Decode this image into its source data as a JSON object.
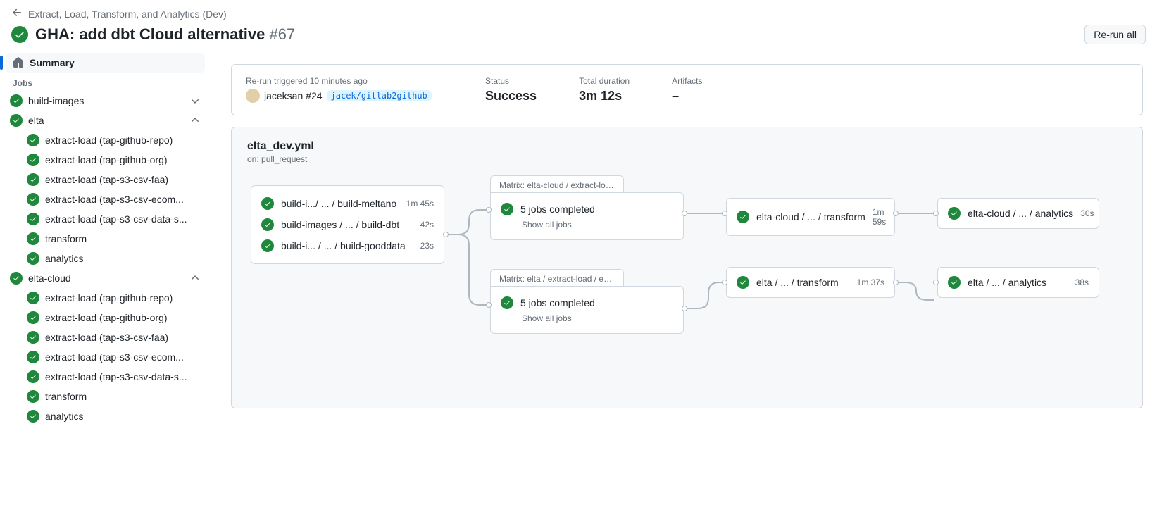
{
  "breadcrumb": "Extract, Load, Transform, and Analytics (Dev)",
  "title": "GHA: add dbt Cloud alternative",
  "run_number": "#67",
  "rerun_btn": "Re-run all",
  "sidebar": {
    "summary": "Summary",
    "jobs_label": "Jobs",
    "groups": [
      {
        "name": "build-images",
        "expanded": false,
        "jobs": []
      },
      {
        "name": "elta",
        "expanded": true,
        "jobs": [
          "extract-load (tap-github-repo)",
          "extract-load (tap-github-org)",
          "extract-load (tap-s3-csv-faa)",
          "extract-load (tap-s3-csv-ecom...",
          "extract-load (tap-s3-csv-data-s...",
          "transform",
          "analytics"
        ]
      },
      {
        "name": "elta-cloud",
        "expanded": true,
        "jobs": [
          "extract-load (tap-github-repo)",
          "extract-load (tap-github-org)",
          "extract-load (tap-s3-csv-faa)",
          "extract-load (tap-s3-csv-ecom...",
          "extract-load (tap-s3-csv-data-s...",
          "transform",
          "analytics"
        ]
      }
    ]
  },
  "info": {
    "trigger_text": "Re-run triggered 10 minutes ago",
    "user": "jaceksan",
    "attempt": "#24",
    "branch": "jacek/gitlab2github",
    "status_label": "Status",
    "status_value": "Success",
    "duration_label": "Total duration",
    "duration_value": "3m 12s",
    "artifacts_label": "Artifacts",
    "artifacts_value": "–"
  },
  "workflow": {
    "file": "elta_dev.yml",
    "on": "on: pull_request",
    "build_nodes": [
      {
        "label": "build-i.../ ... / build-meltano",
        "time": "1m 45s"
      },
      {
        "label": "build-images / ... / build-dbt",
        "time": "42s"
      },
      {
        "label": "build-i...   / ... / build-gooddata",
        "time": "23s"
      }
    ],
    "matrix1": {
      "tab": "Matrix: elta-cloud / extract-load / ...",
      "summary": "5 jobs completed",
      "show": "Show all jobs"
    },
    "matrix2": {
      "tab": "Matrix: elta / extract-load / extract...",
      "summary": "5 jobs completed",
      "show": "Show all jobs"
    },
    "n1": {
      "label": "elta-cloud / ... / transform",
      "time": "1m 59s"
    },
    "n2": {
      "label": "elta-cloud / ... / analytics",
      "time": "30s"
    },
    "n3": {
      "label": "elta / ... / transform",
      "time": "1m 37s"
    },
    "n4": {
      "label": "elta / ... / analytics",
      "time": "38s"
    }
  }
}
